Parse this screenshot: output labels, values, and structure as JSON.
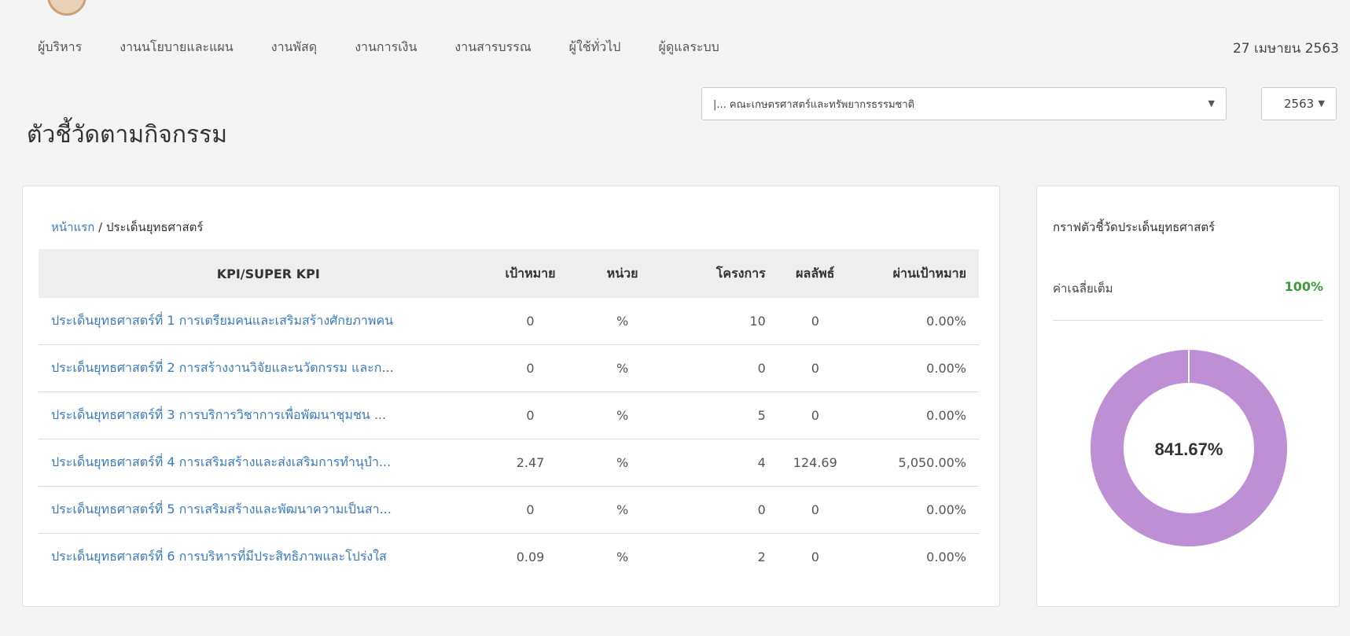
{
  "nav": {
    "items": [
      "ผู้บริหาร",
      "งานนโยบายและแผน",
      "งานพัสดุ",
      "งานการเงิน",
      "งานสารบรรณ",
      "ผู้ใช้ทั่วไป",
      "ผู้ดูแลระบบ"
    ],
    "date": "27 เมษายน 2563"
  },
  "page": {
    "title": "ตัวชี้วัดตามกิจกรรม"
  },
  "filters": {
    "faculty": "|... คณะเกษตรศาสตร์และทรัพยากรธรรมชาติ",
    "year": "2563"
  },
  "breadcrumb": {
    "home": "หน้าแรก",
    "separator": " / ",
    "current": "ประเด็นยุทธศาสตร์"
  },
  "table": {
    "headers": {
      "name": "KPI/SUPER KPI",
      "target": "เป้าหมาย",
      "unit": "หน่วย",
      "projects": "โครงการ",
      "result": "ผลลัพธ์",
      "passed": "ผ่านเป้าหมาย"
    },
    "rows": [
      {
        "name": "ประเด็นยุทธศาสตร์ที่ 1 การเตรียมคนและเสริมสร้างศักยภาพคน",
        "target": "0",
        "unit": "%",
        "projects": "10",
        "result": "0",
        "passed": "0.00%"
      },
      {
        "name": "ประเด็นยุทธศาสตร์ที่ 2 การสร้างงานวิจัยและนวัตกรรม และก...",
        "target": "0",
        "unit": "%",
        "projects": "0",
        "result": "0",
        "passed": "0.00%"
      },
      {
        "name": "ประเด็นยุทธศาสตร์ที่ 3 การบริการวิชาการเพื่อพัฒนาชุมชน ...",
        "target": "0",
        "unit": "%",
        "projects": "5",
        "result": "0",
        "passed": "0.00%"
      },
      {
        "name": "ประเด็นยุทธศาสตร์ที่ 4 การเสริมสร้างและส่งเสริมการทำนุบำ...",
        "target": "2.47",
        "unit": "%",
        "projects": "4",
        "result": "124.69",
        "passed": "5,050.00%"
      },
      {
        "name": "ประเด็นยุทธศาสตร์ที่ 5 การเสริมสร้างและพัฒนาความเป็นสา...",
        "target": "0",
        "unit": "%",
        "projects": "0",
        "result": "0",
        "passed": "0.00%"
      },
      {
        "name": "ประเด็นยุทธศาสตร์ที่ 6 การบริหารที่มีประสิทธิภาพและโปร่งใส",
        "target": "0.09",
        "unit": "%",
        "projects": "2",
        "result": "0",
        "passed": "0.00%"
      }
    ]
  },
  "chart_panel": {
    "title": "กราฟตัวชี้วัดประเด็นยุทธศาสตร์",
    "avg_label": "ค่าเฉลี่ยเต็ม",
    "avg_value": "100%",
    "center_value": "841.67%",
    "ring_color": "#bf8fd6",
    "avg_color": "#3c9a3c",
    "link_color": "#3a7bbf"
  },
  "chart_data": {
    "type": "pie",
    "center_label": "841.67%",
    "values": [
      100
    ],
    "colors": [
      "#bf8fd6"
    ]
  }
}
